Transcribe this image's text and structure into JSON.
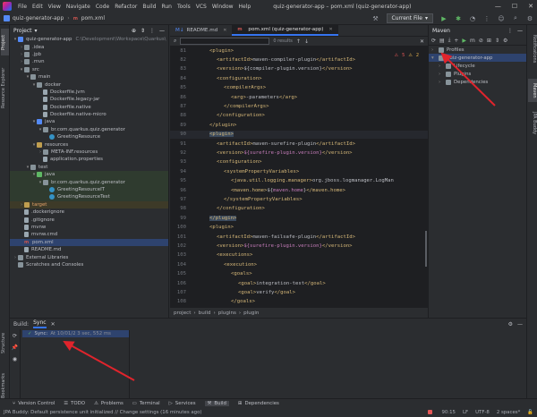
{
  "app": {
    "window_title": "quiz-generator-app – pom.xml (quiz-generator-app)",
    "menu": [
      "File",
      "Edit",
      "View",
      "Navigate",
      "Code",
      "Refactor",
      "Build",
      "Run",
      "Tools",
      "VCS",
      "Window",
      "Help"
    ]
  },
  "navbar": {
    "project": "quiz-generator-app",
    "file": "pom.xml",
    "run_config": "Current File",
    "run_config_arrow": "▾"
  },
  "left_stripe": {
    "project_tab": "Project",
    "explorer_tab": "Resource Explorer",
    "structure_tab": "Structure",
    "bookmarks_tab": "Bookmarks"
  },
  "right_stripe": {
    "notifications_tab": "Notifications",
    "maven_tab": "Maven",
    "jpa_tab": "JPA Buddy"
  },
  "project_panel": {
    "title": "Project",
    "rows": [
      {
        "indent": 0,
        "arrow": "▾",
        "icon": "folder-blue",
        "label": "quiz-generator-app",
        "extra": "C:\\Development\\Workspace\\Quarkus\\"
      },
      {
        "indent": 1,
        "arrow": "›",
        "icon": "folder",
        "label": ".idea",
        "extra": ""
      },
      {
        "indent": 1,
        "arrow": "›",
        "icon": "folder",
        "label": ".jpb",
        "extra": ""
      },
      {
        "indent": 1,
        "arrow": "›",
        "icon": "folder",
        "label": ".mvn",
        "extra": ""
      },
      {
        "indent": 1,
        "arrow": "▾",
        "icon": "folder",
        "label": "src",
        "extra": ""
      },
      {
        "indent": 2,
        "arrow": "▾",
        "icon": "folder",
        "label": "main",
        "extra": ""
      },
      {
        "indent": 3,
        "arrow": "▾",
        "icon": "folder",
        "label": "docker",
        "extra": ""
      },
      {
        "indent": 4,
        "arrow": "",
        "icon": "file",
        "label": "Dockerfile.jvm",
        "extra": ""
      },
      {
        "indent": 4,
        "arrow": "",
        "icon": "file",
        "label": "Dockerfile.legacy-jar",
        "extra": ""
      },
      {
        "indent": 4,
        "arrow": "",
        "icon": "file",
        "label": "Dockerfile.native",
        "extra": ""
      },
      {
        "indent": 4,
        "arrow": "",
        "icon": "file",
        "label": "Dockerfile.native-micro",
        "extra": ""
      },
      {
        "indent": 3,
        "arrow": "▾",
        "icon": "folder-blue",
        "label": "java",
        "extra": ""
      },
      {
        "indent": 4,
        "arrow": "▾",
        "icon": "folder",
        "label": "br.com.quarkus.quiz.generator",
        "extra": ""
      },
      {
        "indent": 5,
        "arrow": "",
        "icon": "class",
        "label": "GreetingResource",
        "extra": ""
      },
      {
        "indent": 3,
        "arrow": "▾",
        "icon": "folder-orange",
        "label": "resources",
        "extra": ""
      },
      {
        "indent": 4,
        "arrow": "›",
        "icon": "folder",
        "label": "META-INF.resources",
        "extra": ""
      },
      {
        "indent": 4,
        "arrow": "",
        "icon": "file",
        "label": "application.properties",
        "extra": ""
      },
      {
        "indent": 2,
        "arrow": "▾",
        "icon": "folder",
        "label": "test",
        "extra": ""
      },
      {
        "indent": 3,
        "arrow": "▾",
        "icon": "folder-green",
        "label": "java",
        "extra": "",
        "style": "green"
      },
      {
        "indent": 4,
        "arrow": "▾",
        "icon": "folder",
        "label": "br.com.quarkus.quiz.generator",
        "extra": "",
        "style": "green"
      },
      {
        "indent": 5,
        "arrow": "",
        "icon": "class",
        "label": "GreetingResourceIT",
        "extra": "",
        "style": "green"
      },
      {
        "indent": 5,
        "arrow": "",
        "icon": "class",
        "label": "GreetingResourceTest",
        "extra": "",
        "style": "green"
      },
      {
        "indent": 1,
        "arrow": "›",
        "icon": "folder-orange",
        "label": "target",
        "extra": "",
        "style": "yellow"
      },
      {
        "indent": 1,
        "arrow": "",
        "icon": "file",
        "label": ".dockerignore",
        "extra": ""
      },
      {
        "indent": 1,
        "arrow": "",
        "icon": "file",
        "label": ".gitignore",
        "extra": ""
      },
      {
        "indent": 1,
        "arrow": "",
        "icon": "file",
        "label": "mvnw",
        "extra": ""
      },
      {
        "indent": 1,
        "arrow": "",
        "icon": "file",
        "label": "mvnw.cmd",
        "extra": ""
      },
      {
        "indent": 1,
        "arrow": "",
        "icon": "m",
        "label": "pom.xml",
        "extra": "",
        "style": "selected"
      },
      {
        "indent": 1,
        "arrow": "",
        "icon": "file",
        "label": "README.md",
        "extra": ""
      },
      {
        "indent": 0,
        "arrow": "›",
        "icon": "folder",
        "label": "External Libraries",
        "extra": ""
      },
      {
        "indent": 0,
        "arrow": "",
        "icon": "folder",
        "label": "Scratches and Consoles",
        "extra": ""
      }
    ]
  },
  "editor": {
    "tabs": [
      {
        "label": "README.md",
        "active": false
      },
      {
        "label": "pom.xml (quiz-generator-app)",
        "active": true
      }
    ],
    "find_results": "0 results",
    "warnings": "5",
    "weak_warnings": "2",
    "lines": [
      {
        "n": "81",
        "html": "<span class='tag'>&lt;plugin&gt;</span>",
        "indent": 2
      },
      {
        "n": "82",
        "html": "<span class='tag'>&lt;artifactId&gt;</span>maven-compiler-plugin<span class='tag'>&lt;/artifactId&gt;</span>",
        "indent": 3
      },
      {
        "n": "83",
        "html": "<span class='tag'>&lt;version&gt;</span>${compiler-plugin.version}<span class='tag'>&lt;/version&gt;</span>",
        "indent": 3
      },
      {
        "n": "84",
        "html": "<span class='tag'>&lt;configuration&gt;</span>",
        "indent": 3
      },
      {
        "n": "85",
        "html": "<span class='tag'>&lt;compilerArgs&gt;</span>",
        "indent": 4
      },
      {
        "n": "86",
        "html": "<span class='tag'>&lt;arg&gt;</span>-parameters<span class='tag'>&lt;/arg&gt;</span>",
        "indent": 5
      },
      {
        "n": "87",
        "html": "<span class='tag'>&lt;/compilerArgs&gt;</span>",
        "indent": 4
      },
      {
        "n": "88",
        "html": "<span class='tag'>&lt;/configuration&gt;</span>",
        "indent": 3
      },
      {
        "n": "89",
        "html": "<span class='tag'>&lt;/plugin&gt;</span>",
        "indent": 2
      },
      {
        "n": "90",
        "html": "<span class='tag sel-tag'>&lt;plugin&gt;</span>",
        "indent": 2,
        "hl": true
      },
      {
        "n": "91",
        "html": "<span class='tag'>&lt;artifactId&gt;</span>maven-surefire-plugin<span class='tag'>&lt;/artifactId&gt;</span>",
        "indent": 3
      },
      {
        "n": "92",
        "html": "<span class='tag'>&lt;version&gt;</span><span class='var'>${surefire-plugin.version}</span><span class='tag'>&lt;/version&gt;</span>",
        "indent": 3
      },
      {
        "n": "93",
        "html": "<span class='tag'>&lt;configuration&gt;</span>",
        "indent": 3
      },
      {
        "n": "94",
        "html": "<span class='tag'>&lt;systemPropertyVariables&gt;</span>",
        "indent": 4
      },
      {
        "n": "95",
        "html": "<span class='tag'>&lt;java.util.logging.manager&gt;</span>org.jboss.logmanager.LogMan",
        "indent": 5
      },
      {
        "n": "96",
        "html": "<span class='tag'>&lt;maven.home&gt;</span>${<span class='var'>maven.home</span>}<span class='tag'>&lt;/maven.home&gt;</span>",
        "indent": 5
      },
      {
        "n": "97",
        "html": "<span class='tag'>&lt;/systemPropertyVariables&gt;</span>",
        "indent": 4
      },
      {
        "n": "98",
        "html": "<span class='tag'>&lt;/configuration&gt;</span>",
        "indent": 3
      },
      {
        "n": "99",
        "html": "<span class='tag sel-tag'>&lt;/plugin&gt;</span>",
        "indent": 2
      },
      {
        "n": "100",
        "html": "<span class='tag'>&lt;plugin&gt;</span>",
        "indent": 2
      },
      {
        "n": "101",
        "html": "<span class='tag'>&lt;artifactId&gt;</span>maven-failsafe-plugin<span class='tag'>&lt;/artifactId&gt;</span>",
        "indent": 3
      },
      {
        "n": "102",
        "html": "<span class='tag'>&lt;version&gt;</span><span class='var'>${surefire-plugin.version}</span><span class='tag'>&lt;/version&gt;</span>",
        "indent": 3
      },
      {
        "n": "103",
        "html": "<span class='tag'>&lt;executions&gt;</span>",
        "indent": 3
      },
      {
        "n": "104",
        "html": "<span class='tag'>&lt;execution&gt;</span>",
        "indent": 4
      },
      {
        "n": "105",
        "html": "<span class='tag'>&lt;goals&gt;</span>",
        "indent": 5
      },
      {
        "n": "106",
        "html": "<span class='tag'>&lt;goal&gt;</span>integration-test<span class='tag'>&lt;/goal&gt;</span>",
        "indent": 6
      },
      {
        "n": "107",
        "html": "<span class='tag'>&lt;goal&gt;</span>verify<span class='tag'>&lt;/goal&gt;</span>",
        "indent": 6
      },
      {
        "n": "108",
        "html": "<span class='tag'>&lt;/goals&gt;</span>",
        "indent": 5
      }
    ],
    "breadcrumbs": [
      "project",
      "build",
      "plugins",
      "plugin"
    ]
  },
  "maven": {
    "title": "Maven",
    "rows": [
      {
        "indent": 0,
        "arrow": "›",
        "label": "Profiles",
        "selected": false
      },
      {
        "indent": 0,
        "arrow": "▾",
        "label": "quiz-generator-app",
        "selected": true
      },
      {
        "indent": 1,
        "arrow": "›",
        "label": "Lifecycle",
        "selected": false
      },
      {
        "indent": 1,
        "arrow": "›",
        "label": "Plugins",
        "selected": false
      },
      {
        "indent": 1,
        "arrow": "›",
        "label": "Dependencies",
        "selected": false
      }
    ]
  },
  "build_panel": {
    "title": "Build:",
    "tab": "Sync",
    "row_label": "Sync:",
    "row_detail": "At 10/01/2 3 sec, 552 ms"
  },
  "bottom_tools": [
    {
      "label": "Version Control",
      "active": false
    },
    {
      "label": "TODO",
      "active": false
    },
    {
      "label": "Problems",
      "active": false
    },
    {
      "label": "Terminal",
      "active": false
    },
    {
      "label": "Services",
      "active": false
    },
    {
      "label": "Build",
      "active": true
    },
    {
      "label": "Dependencies",
      "active": false
    }
  ],
  "status_bar": {
    "message": "JPA Buddy: Default persistence unit initialized // Change settings (16 minutes ago)",
    "position": "90:15",
    "line_sep": "LF",
    "encoding": "UTF-8",
    "indent": "2 spaces*"
  },
  "colors": {
    "accent": "#3574f0",
    "arrow": "#e0242c",
    "background": "#2b2d30",
    "editor_bg": "#1e1f22"
  }
}
